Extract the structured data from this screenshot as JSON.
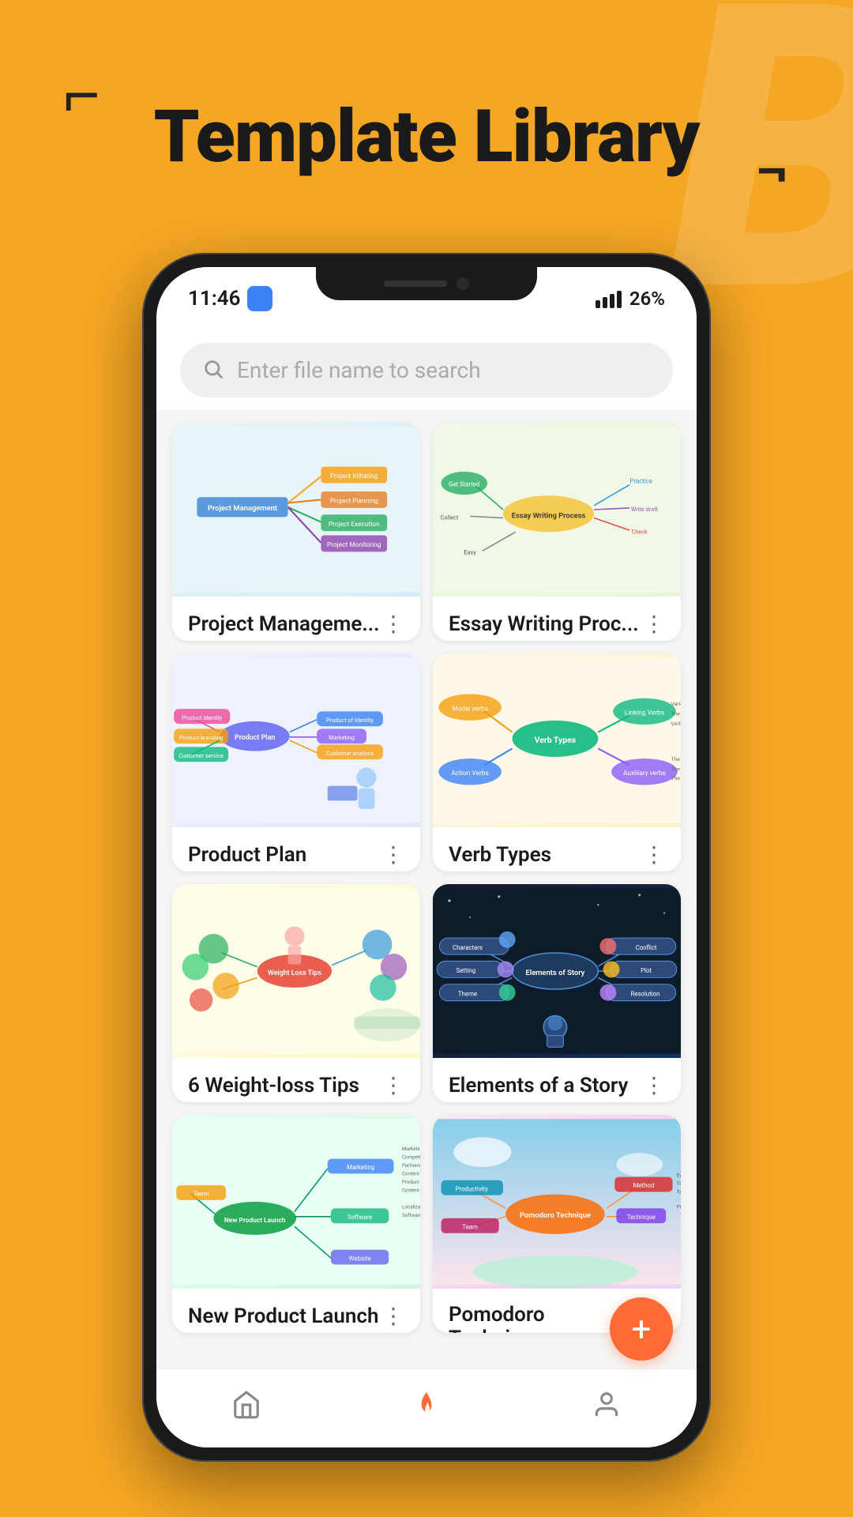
{
  "header": {
    "title": "Template Library",
    "bracket_tl": "⌐",
    "bracket_br": "¬"
  },
  "status_bar": {
    "time": "11:46",
    "battery": "26%",
    "wifi": true
  },
  "search": {
    "placeholder": "Enter file name to search"
  },
  "templates": [
    {
      "id": "project-management",
      "title": "Project Manageme...",
      "thumb_type": "pm"
    },
    {
      "id": "essay-writing",
      "title": "Essay Writing Proc...",
      "thumb_type": "essay"
    },
    {
      "id": "product-plan",
      "title": "Product Plan",
      "thumb_type": "product"
    },
    {
      "id": "verb-types",
      "title": "Verb Types",
      "thumb_type": "verb"
    },
    {
      "id": "weight-loss",
      "title": "6 Weight-loss Tips",
      "thumb_type": "weight"
    },
    {
      "id": "elements-story",
      "title": "Elements of a Story",
      "thumb_type": "story"
    },
    {
      "id": "new-product-launch",
      "title": "New Product Launch",
      "thumb_type": "launch"
    },
    {
      "id": "pomodoro",
      "title": "Pomodoro Technique",
      "thumb_type": "pomodo"
    }
  ],
  "nav": {
    "items": [
      {
        "id": "home",
        "icon": "⌂",
        "active": false
      },
      {
        "id": "fire",
        "icon": "🔥",
        "active": true
      },
      {
        "id": "user",
        "icon": "◯",
        "active": false
      }
    ]
  },
  "fab": {
    "label": "+"
  }
}
